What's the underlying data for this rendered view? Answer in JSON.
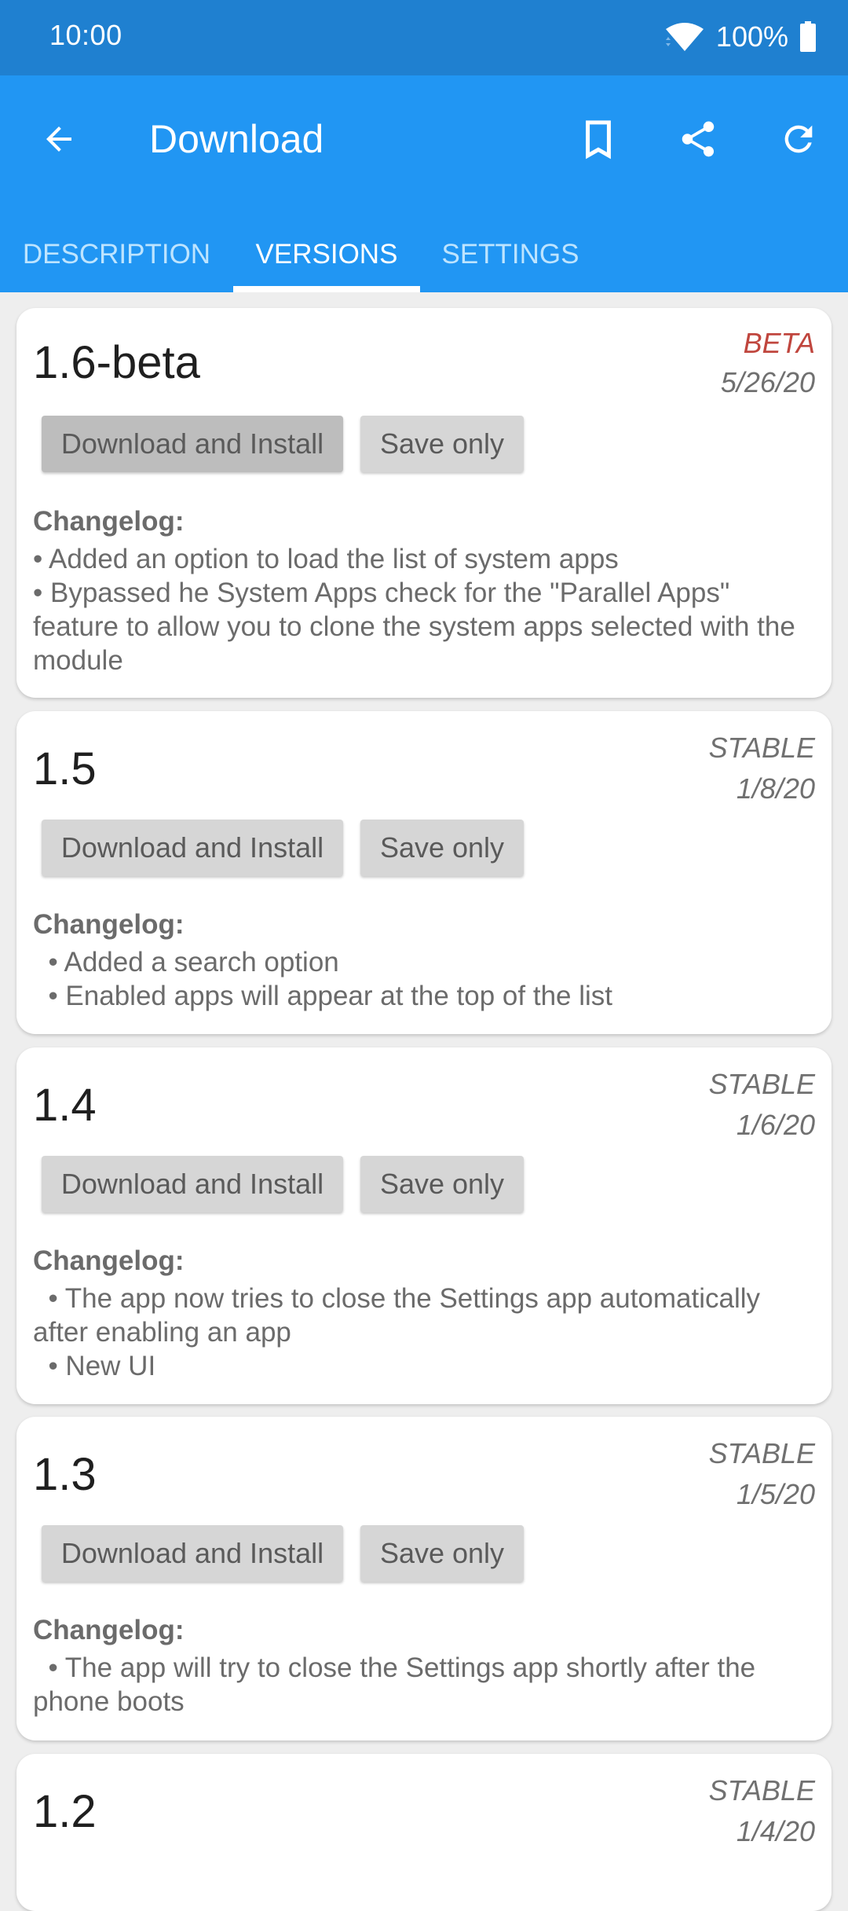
{
  "status_bar": {
    "time": "10:00",
    "battery_percent": "100%",
    "icons": [
      "wifi-icon",
      "battery-icon"
    ]
  },
  "app_bar": {
    "title": "Download",
    "back_icon": "arrow-left-icon",
    "actions": [
      "bookmark-icon",
      "share-icon",
      "refresh-icon"
    ]
  },
  "tabs": [
    {
      "label": "DESCRIPTION",
      "active": false
    },
    {
      "label": "VERSIONS",
      "active": true
    },
    {
      "label": "SETTINGS",
      "active": false
    }
  ],
  "colors": {
    "status_bar": "#1f80d0",
    "app_bar": "#2196f3",
    "beta": "#c0463e",
    "stable": "#707070"
  },
  "versions": [
    {
      "name": "1.6-beta",
      "channel": "BETA",
      "date": "5/26/20",
      "download_label": "Download and Install",
      "save_label": "Save only",
      "changelog_title": "Changelog:",
      "changelog": "• Added an option to load the list of system apps\n• Bypassed he System Apps check for the \"Parallel Apps\" feature to allow you to clone the system apps selected with the module"
    },
    {
      "name": "1.5",
      "channel": "STABLE",
      "date": "1/8/20",
      "download_label": "Download and Install",
      "save_label": "Save only",
      "changelog_title": "Changelog:",
      "changelog": "  • Added a search option\n  • Enabled apps will appear at the top of the list"
    },
    {
      "name": "1.4",
      "channel": "STABLE",
      "date": "1/6/20",
      "download_label": "Download and Install",
      "save_label": "Save only",
      "changelog_title": "Changelog:",
      "changelog": "  • The app now tries to close the Settings app automatically after enabling an app\n  • New UI"
    },
    {
      "name": "1.3",
      "channel": "STABLE",
      "date": "1/5/20",
      "download_label": "Download and Install",
      "save_label": "Save only",
      "changelog_title": "Changelog:",
      "changelog": "  • The app will try to close the Settings app shortly after the phone boots"
    },
    {
      "name": "1.2",
      "channel": "STABLE",
      "date": "1/4/20"
    }
  ]
}
